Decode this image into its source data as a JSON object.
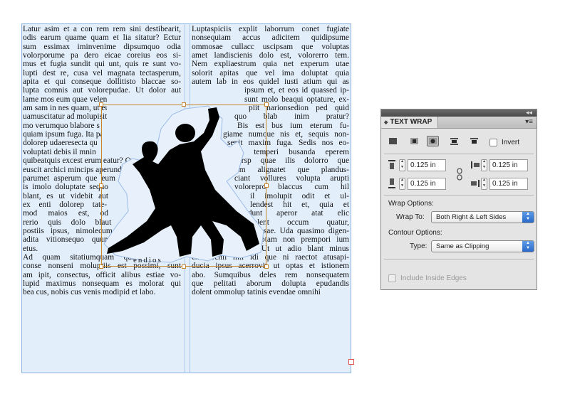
{
  "document": {
    "left_column": [
      "Latur asim et a con rem rem sini destibearit,",
      "odis earum quame quam et lia sitatur? Ectur",
      "sum essimax iminvenime dipsumquo odia",
      "volorporume pa dero eicae coreius eos si-",
      "mus et fugia sundit qui unt, quis re sunt vo-",
      "lupti dest re, cusa vel magnata tectasperum,",
      "apita et qui conseque dollitisto blaccae so-",
      "lupta comnis aut volorepudae. Ut dolor aut",
      "lame mos eum quae veleni denectem",
      "am sam in nes quam, ut eum, velitaq",
      "uamuscitatur ad molupisitiis mod",
      "mo verumquo blabore se-",
      "quiam ipsum fuga. Ita parum",
      "dolorep udaeresecta quas est",
      "voluptati debis il mnimint,",
      "quibeatquis excest erum eatur? Oc-",
      "euscit archici mincips aperundita",
      "parumet asperum que eum",
      "is imolo doluptate sequo",
      "blant, es ut videbit aut",
      "ex enti dolorep tate-",
      "mod maios est, od",
      "rerio quis dolo blaut eos ipide quis",
      "postiis ipsus, nimolecum renissecatus eatur",
      "adita vitionsequo quuntem experis estrum",
      "etus.",
      "Ad quam sitatiumquam quiditi comnim",
      "conse nonseni moluptiis est possimi, sunt",
      "am ipit, consectus, officit alibus estiae vo-",
      "lupid maximus nonsequam es molorat qui",
      "bea cus, nobis cus venis modipid et labo."
    ],
    "right_column": [
      "Luptaspiciis explit laborrum conet fugiate",
      "nonsequiam accus adicitem quidipsume",
      "ommosae cullacc uscipsam que voluptas",
      "amet landiscienis dolo est, volorerro tem.",
      "Nem expliaestrum quia net experum utae",
      "solorit apitas que vel ima doluptat quia",
      "autem lab in eos quidel iusti atium qui as",
      "ipsum et, et eos id quassed ip-",
      "sunt molo beaqui optature, ex-",
      "plit harionsedion ped quid",
      "quo blab inim pratur?",
      "Bis est bus ium eterum fu-",
      "giame numque nis et, sequis non-",
      "senit maxim fuga. Sedis nos eo-",
      "sam, temperi busanda eperem",
      "exersp quae ilis dolorro que",
      "nem alignatet que plandus-",
      "ciant vollures volupta arupti",
      "voloreprо blaccus cum hil",
      "il imolupit odit et ul-",
      "lendest hit et, quia et",
      "vidunt aperor atat elic",
      "tempelent occum quatur,",
      "quasite volupture ra sae. Uda quasimo digen-",
      "dem. Accabor poreptam non prempori ium",
      "volupta spelitatur? Ut ut adio blant minus",
      "exerferchil mil idi que ni raectot atusapi-",
      "ducia ipsus acerrovit ut optas et istionem",
      "abo. Sumquibus deles rem nonsequatem",
      "que pelitati aborum dolupta epudandis",
      "dolent ommolup tatinis evendae omnihi"
    ],
    "caption": "endios"
  },
  "panel": {
    "title": "TEXT WRAP",
    "collapse_symbol": "◂◂",
    "menu_symbol": "▾≡",
    "wrap_buttons": [
      {
        "name": "no-text-wrap",
        "selected": false
      },
      {
        "name": "wrap-around-bounding-box",
        "selected": false
      },
      {
        "name": "wrap-around-object-shape",
        "selected": true
      },
      {
        "name": "jump-object",
        "selected": false
      },
      {
        "name": "jump-to-next-column",
        "selected": false
      }
    ],
    "invert_label": "Invert",
    "offsets": {
      "top": "0.125 in",
      "bottom": "0.125 in",
      "left": "0.125 in",
      "right": "0.125 in"
    },
    "wrap_options_label": "Wrap Options:",
    "wrap_to_label": "Wrap To:",
    "wrap_to_value": "Both Right & Left Sides",
    "contour_options_label": "Contour Options:",
    "type_label": "Type:",
    "type_value": "Same as Clipping",
    "include_inside_edges_label": "Include Inside Edges",
    "colors": {
      "accent": "#2a69c9",
      "frame": "#8fb3e0",
      "object_frame": "#c7862b"
    }
  }
}
